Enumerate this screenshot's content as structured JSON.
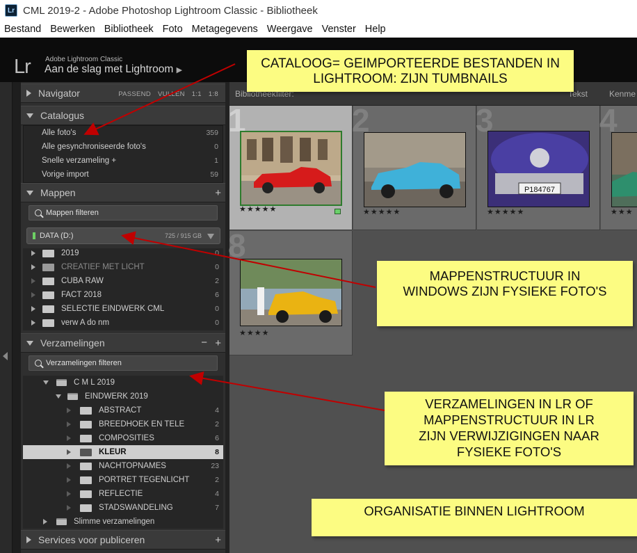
{
  "window": {
    "title": "CML 2019-2 - Adobe Photoshop Lightroom Classic - Bibliotheek",
    "app_icon": "Lr"
  },
  "menu": [
    "Bestand",
    "Bewerken",
    "Bibliotheek",
    "Foto",
    "Metagegevens",
    "Weergave",
    "Venster",
    "Help"
  ],
  "identity": {
    "logo": "Lr",
    "product": "Adobe Lightroom Classic",
    "catalog_name": "Aan de slag met Lightroom"
  },
  "navigator": {
    "title": "Navigator",
    "options": [
      "PASSEND",
      "VULLEN",
      "1:1",
      "1:8"
    ]
  },
  "catalogus": {
    "title": "Catalogus",
    "items": [
      {
        "label": "Alle foto's",
        "count": "359"
      },
      {
        "label": "Alle gesynchroniseerde foto's",
        "count": "0"
      },
      {
        "label": "Snelle verzameling +",
        "count": "1"
      },
      {
        "label": "Vorige import",
        "count": "59"
      }
    ]
  },
  "mappen": {
    "title": "Mappen",
    "filter": "Mappen filteren",
    "volume": {
      "name": "DATA (D:)",
      "capacity": "725 / 915 GB"
    },
    "folders": [
      {
        "label": "2019",
        "count": "0"
      },
      {
        "label": "CREATIEF MET LICHT",
        "count": "0"
      },
      {
        "label": "CUBA RAW",
        "count": "2"
      },
      {
        "label": "FACT 2018",
        "count": "6"
      },
      {
        "label": "SELECTIE EINDWERK CML",
        "count": "0"
      },
      {
        "label": "verw A do nm",
        "count": "0"
      }
    ]
  },
  "verzamelingen": {
    "title": "Verzamelingen",
    "filter": "Verzamelingen filteren",
    "set": "C M L  2019",
    "subset": "EINDWERK 2019",
    "items": [
      {
        "label": "ABSTRACT",
        "count": "4"
      },
      {
        "label": "BREEDHOEK  EN TELE",
        "count": "2"
      },
      {
        "label": "COMPOSITIES",
        "count": "6"
      },
      {
        "label": "KLEUR",
        "count": "8"
      },
      {
        "label": "NACHTOPNAMES",
        "count": "23"
      },
      {
        "label": "PORTRET TEGENLICHT",
        "count": "2"
      },
      {
        "label": "REFLECTIE",
        "count": "4"
      },
      {
        "label": "STADSWANDELING",
        "count": "7"
      }
    ],
    "smart": "Slimme verzamelingen"
  },
  "publish": {
    "title": "Services voor publiceren"
  },
  "filterbar": {
    "label": "Bibliotheekfilter:",
    "tabs": [
      "Tekst",
      "Kenme"
    ]
  },
  "grid": {
    "cells": [
      {
        "index": "1",
        "stars": "★★★★★"
      },
      {
        "index": "2",
        "stars": "★★★★★"
      },
      {
        "index": "3",
        "stars": "★★★★★"
      },
      {
        "index": "4",
        "stars": "★★★"
      },
      {
        "index": "8",
        "stars": "★★★★"
      }
    ],
    "plate": "P184767"
  },
  "callouts": {
    "catalog": "CATALOOG=  GEIMPORTEERDE BESTANDEN IN LIGHTROOM:  ZIJN TUMBNAILS",
    "mappen": "MAPPENSTRUCTUUR IN WINDOWS ZIJN FYSIEKE FOTO'S",
    "verzamelingen": "VERZAMELINGEN IN LR OF MAPPENSTRUCTUUR IN LR ZIJN VERWIJZIGINGEN NAAR FYSIEKE FOTO'S",
    "organisatie": "ORGANISATIE BINNEN LIGHTROOM"
  },
  "colors": {
    "callout": "#fcfc82",
    "arrow": "#c00000",
    "selected_row": "#cfcfcf"
  }
}
